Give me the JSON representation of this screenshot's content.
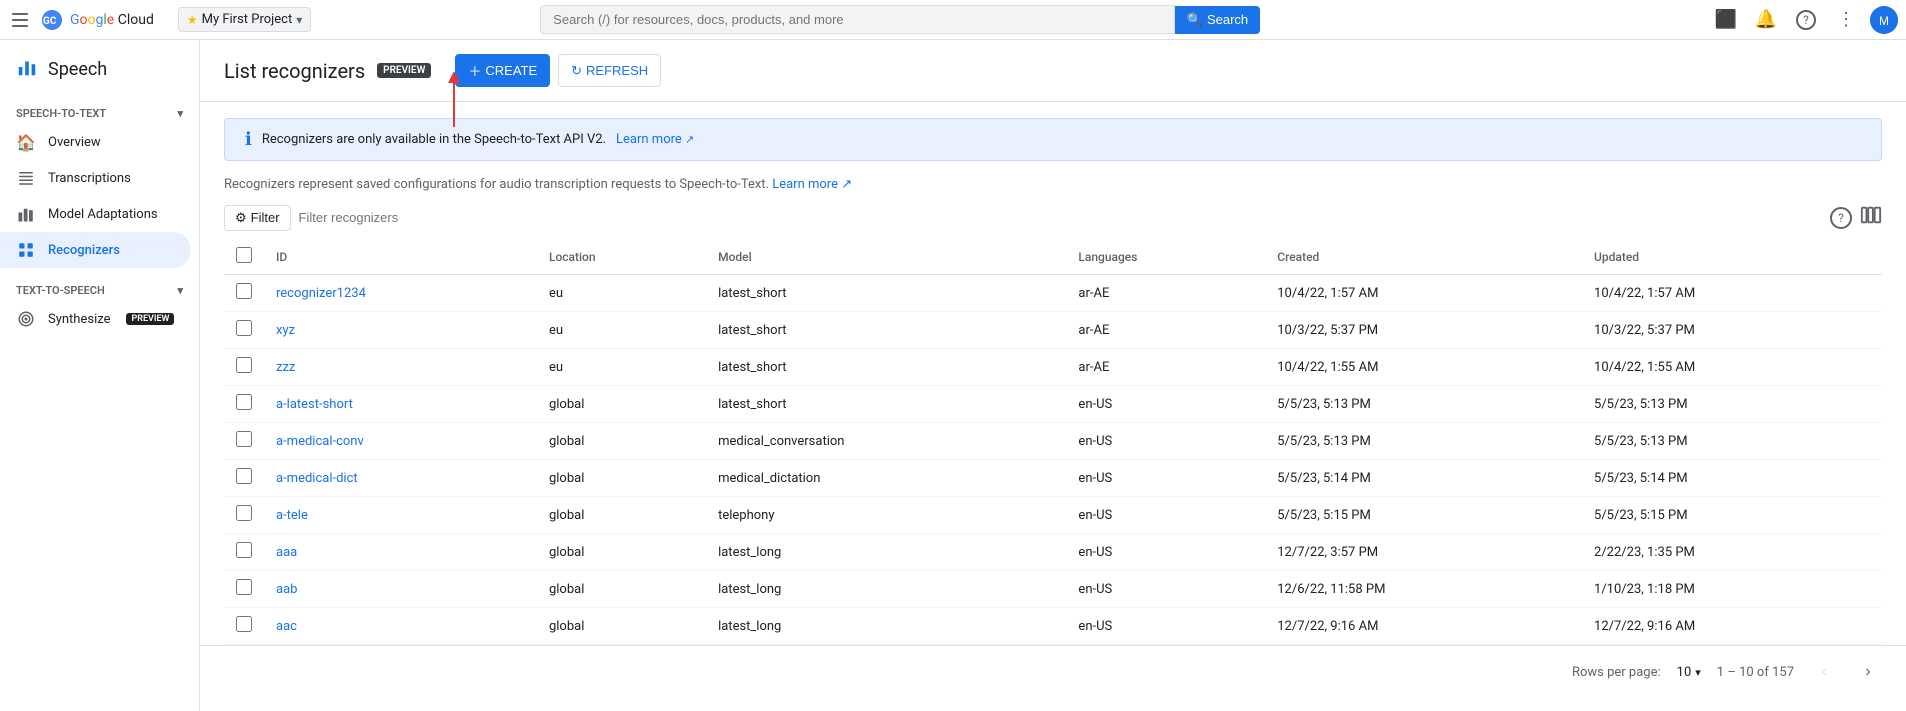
{
  "topbar": {
    "project": {
      "name": "My First Project",
      "dropdown_label": "My First Project"
    },
    "search": {
      "placeholder": "Search (/) for resources, docs, products, and more",
      "button_label": "Search"
    },
    "icons": {
      "menu": "☰",
      "terminal": "⬛",
      "bell": "🔔",
      "help": "?",
      "more": "⋮",
      "avatar_text": "M"
    }
  },
  "sidebar": {
    "header": {
      "label": "Speech"
    },
    "sections": [
      {
        "label": "Speech-to-Text",
        "collapsible": true,
        "items": [
          {
            "id": "overview",
            "label": "Overview",
            "icon": "home"
          },
          {
            "id": "transcriptions",
            "label": "Transcriptions",
            "icon": "list"
          },
          {
            "id": "model-adaptations",
            "label": "Model Adaptations",
            "icon": "bar_chart"
          },
          {
            "id": "recognizers",
            "label": "Recognizers",
            "icon": "grid",
            "active": true
          }
        ]
      },
      {
        "label": "Text-to-Speech",
        "collapsible": true,
        "items": [
          {
            "id": "synthesize",
            "label": "Synthesize",
            "icon": "settings",
            "badge": "PREVIEW"
          }
        ]
      }
    ]
  },
  "main": {
    "title": "List recognizers",
    "title_badge": "PREVIEW",
    "toolbar": {
      "create_label": "CREATE",
      "refresh_label": "REFRESH"
    },
    "info_banner": {
      "text": "Recognizers are only available in the Speech-to-Text API V2.",
      "link_text": "Learn more",
      "link_icon": "↗"
    },
    "description": {
      "text": "Recognizers represent saved configurations for audio transcription requests to Speech-to-Text.",
      "link_text": "Learn more",
      "link_icon": "↗"
    },
    "filter": {
      "button_label": "Filter",
      "placeholder": "Filter recognizers"
    },
    "table": {
      "columns": [
        "",
        "ID",
        "Location",
        "Model",
        "Languages",
        "Created",
        "Updated"
      ],
      "rows": [
        {
          "id": "recognizer1234",
          "location": "eu",
          "model": "latest_short",
          "languages": "ar-AE",
          "created": "10/4/22, 1:57 AM",
          "updated": "10/4/22, 1:57 AM"
        },
        {
          "id": "xyz",
          "location": "eu",
          "model": "latest_short",
          "languages": "ar-AE",
          "created": "10/3/22, 5:37 PM",
          "updated": "10/3/22, 5:37 PM"
        },
        {
          "id": "zzz",
          "location": "eu",
          "model": "latest_short",
          "languages": "ar-AE",
          "created": "10/4/22, 1:55 AM",
          "updated": "10/4/22, 1:55 AM"
        },
        {
          "id": "a-latest-short",
          "location": "global",
          "model": "latest_short",
          "languages": "en-US",
          "created": "5/5/23, 5:13 PM",
          "updated": "5/5/23, 5:13 PM"
        },
        {
          "id": "a-medical-conv",
          "location": "global",
          "model": "medical_conversation",
          "languages": "en-US",
          "created": "5/5/23, 5:13 PM",
          "updated": "5/5/23, 5:13 PM"
        },
        {
          "id": "a-medical-dict",
          "location": "global",
          "model": "medical_dictation",
          "languages": "en-US",
          "created": "5/5/23, 5:14 PM",
          "updated": "5/5/23, 5:14 PM"
        },
        {
          "id": "a-tele",
          "location": "global",
          "model": "telephony",
          "languages": "en-US",
          "created": "5/5/23, 5:15 PM",
          "updated": "5/5/23, 5:15 PM"
        },
        {
          "id": "aaa",
          "location": "global",
          "model": "latest_long",
          "languages": "en-US",
          "created": "12/7/22, 3:57 PM",
          "updated": "2/22/23, 1:35 PM"
        },
        {
          "id": "aab",
          "location": "global",
          "model": "latest_long",
          "languages": "en-US",
          "created": "12/6/22, 11:58 PM",
          "updated": "1/10/23, 1:18 PM"
        },
        {
          "id": "aac",
          "location": "global",
          "model": "latest_long",
          "languages": "en-US",
          "created": "12/7/22, 9:16 AM",
          "updated": "12/7/22, 9:16 AM"
        }
      ]
    },
    "pagination": {
      "rows_label": "Rows per page:",
      "rows_per_page": "10",
      "page_info": "1 – 10 of 157",
      "total": 157,
      "current_start": 1,
      "current_end": 10
    }
  }
}
